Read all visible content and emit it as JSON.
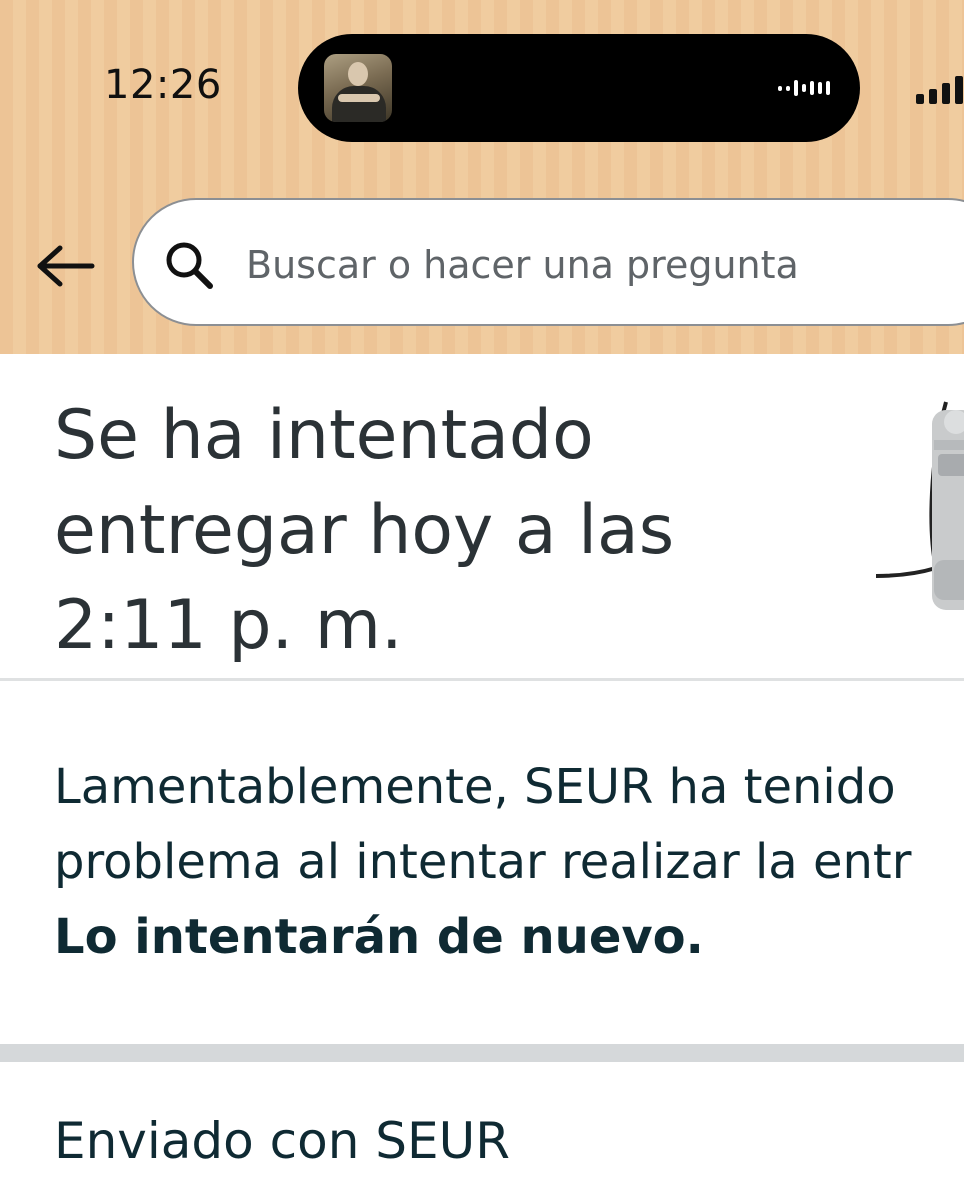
{
  "status_bar": {
    "time": "12:26",
    "live_activity_icon": "audio-waveform-icon",
    "signal_icon": "cellular-signal-icon"
  },
  "header": {
    "back_icon": "back-arrow-icon",
    "search": {
      "icon": "search-icon",
      "placeholder": "Buscar o hacer una pregunta"
    }
  },
  "delivery": {
    "title": "Se ha intentado entregar hoy a las 2:11 p. m.",
    "message_line1": "Lamentablemente, SEUR ha tenido",
    "message_line2": "problema al intentar realizar la entr",
    "message_bold": "Lo intentarán de nuevo.",
    "shipped_with": "Enviado con SEUR"
  },
  "colors": {
    "header_bg": "#edc496",
    "title_text": "#2b3236",
    "body_text": "#0f2a33",
    "divider": "#d5d8da"
  }
}
